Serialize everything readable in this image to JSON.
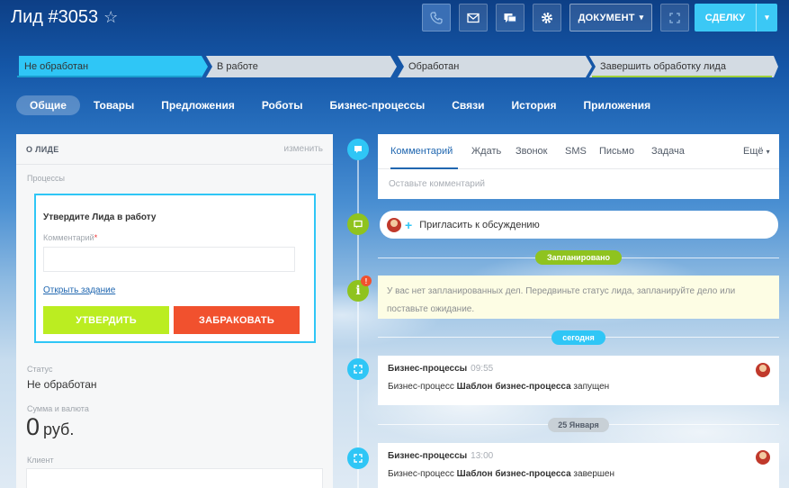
{
  "header": {
    "title": "Лид #3053",
    "star_icon": "star-icon",
    "document_label": "ДОКУМЕНТ",
    "deal_label": "СДЕЛКУ",
    "icons": [
      "phone-icon",
      "mail-icon",
      "chat-icon",
      "gear-icon",
      "cycle-icon"
    ]
  },
  "stages": [
    {
      "label": "Не обработан",
      "color": "#2fc6f6"
    },
    {
      "label": "В работе",
      "color": "#d3dbe3"
    },
    {
      "label": "Обработан",
      "color": "#d3dbe3"
    },
    {
      "label": "Завершить обработку лида",
      "color": "#d3dbe3"
    }
  ],
  "tabs": [
    "Общие",
    "Товары",
    "Предложения",
    "Роботы",
    "Бизнес-процессы",
    "Связи",
    "История",
    "Приложения"
  ],
  "lead": {
    "section_title": "О ЛИДЕ",
    "edit_label": "изменить",
    "processes_label": "Процессы",
    "process": {
      "title": "Утвердите Лида в работу",
      "comment_label": "Комментарий",
      "required_mark": "*",
      "open_task_label": "Открыть задание",
      "approve_label": "УТВЕРДИТЬ",
      "reject_label": "ЗАБРАКОВАТЬ"
    },
    "status_label": "Статус",
    "status_value": "Не обработан",
    "amount_label": "Сумма и валюта",
    "amount_value": "0",
    "currency": "руб.",
    "client_label": "Клиент"
  },
  "timeline": {
    "tabs": [
      "Комментарий",
      "Ждать",
      "Звонок",
      "SMS",
      "Письмо",
      "Задача"
    ],
    "more_label": "Ещё",
    "comment_placeholder": "Оставьте комментарий",
    "invite_label": "Пригласить к обсуждению",
    "planned_label": "Запланировано",
    "planned_empty": "У вас нет запланированных дел. Передвиньте статус лида, запланируйте дело или поставьте ожидание.",
    "warn_badge": "!",
    "today_label": "сегодня",
    "date_label": "25 Января",
    "entries": [
      {
        "title": "Бизнес-процессы",
        "time": "09:55",
        "prefix": "Бизнес-процесс",
        "name": "Шаблон бизнес-процесса",
        "suffix": "запущен"
      },
      {
        "title": "Бизнес-процессы",
        "time": "13:00",
        "prefix": "Бизнес-процесс",
        "name": "Шаблон бизнес-процесса",
        "suffix": "завершен"
      }
    ]
  },
  "colors": {
    "accent": "#2fc6f6",
    "approve": "#bbed21",
    "reject": "#f1512e",
    "planned_pill": "#8fc31f",
    "date_pill": "#c8d0d6"
  }
}
